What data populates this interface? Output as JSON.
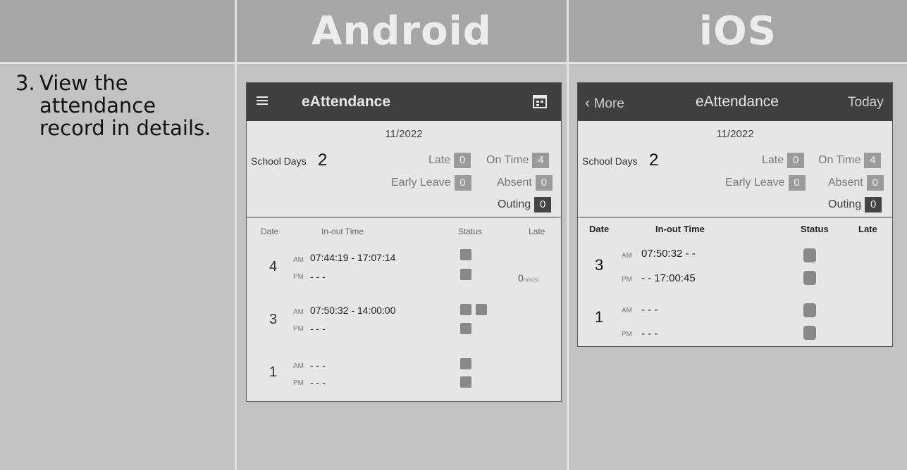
{
  "header": {
    "left": "",
    "android": "Android",
    "ios": "iOS"
  },
  "instruction": {
    "number": "3.",
    "text": "View the attendance record in details."
  },
  "android": {
    "app_title": "eAttendance",
    "menu_icon": "hamburger-icon",
    "calendar_icon": "calendar-icon",
    "month": "11/2022",
    "school_days_label": "School Days",
    "school_days_value": "2",
    "stats": {
      "late": {
        "label": "Late",
        "value": "0"
      },
      "on_time": {
        "label": "On Time",
        "value": "4"
      },
      "early_leave": {
        "label": "Early Leave",
        "value": "0"
      },
      "absent": {
        "label": "Absent",
        "value": "0"
      },
      "outing": {
        "label": "Outing",
        "value": "0"
      }
    },
    "columns": {
      "date": "Date",
      "in_out": "In-out Time",
      "status": "Status",
      "late": "Late"
    },
    "records": [
      {
        "date": "4",
        "am_label": "AM",
        "am_time": "07:44:19 - 17:07:14",
        "pm_label": "PM",
        "pm_time": "- - -",
        "late_value": "0",
        "late_unit": "min(s)"
      },
      {
        "date": "3",
        "am_label": "AM",
        "am_time": "07:50:32 - 14:00:00",
        "pm_label": "PM",
        "pm_time": "- - -"
      },
      {
        "date": "1",
        "am_label": "AM",
        "am_time": "- - -",
        "pm_label": "PM",
        "pm_time": "- - -"
      }
    ]
  },
  "ios": {
    "back_label": "More",
    "app_title": "eAttendance",
    "today_label": "Today",
    "month": "11/2022",
    "school_days_label": "School Days",
    "school_days_value": "2",
    "stats": {
      "late": {
        "label": "Late",
        "value": "0"
      },
      "on_time": {
        "label": "On Time",
        "value": "4"
      },
      "early_leave": {
        "label": "Early Leave",
        "value": "0"
      },
      "absent": {
        "label": "Absent",
        "value": "0"
      },
      "outing": {
        "label": "Outing",
        "value": "0"
      }
    },
    "columns": {
      "date": "Date",
      "in_out": "In-out Time",
      "status": "Status",
      "late": "Late"
    },
    "records": [
      {
        "date": "3",
        "am_label": "AM",
        "am_time": "07:50:32 - -",
        "pm_label": "PM",
        "pm_time": "- - 17:00:45"
      },
      {
        "date": "1",
        "am_label": "AM",
        "am_time": "- - -",
        "pm_label": "PM",
        "pm_time": "- - -"
      }
    ]
  },
  "colors": {
    "header_bg": "#a6a6a6",
    "appbar_bg": "#3f3f3f",
    "status_square": "#888888"
  }
}
